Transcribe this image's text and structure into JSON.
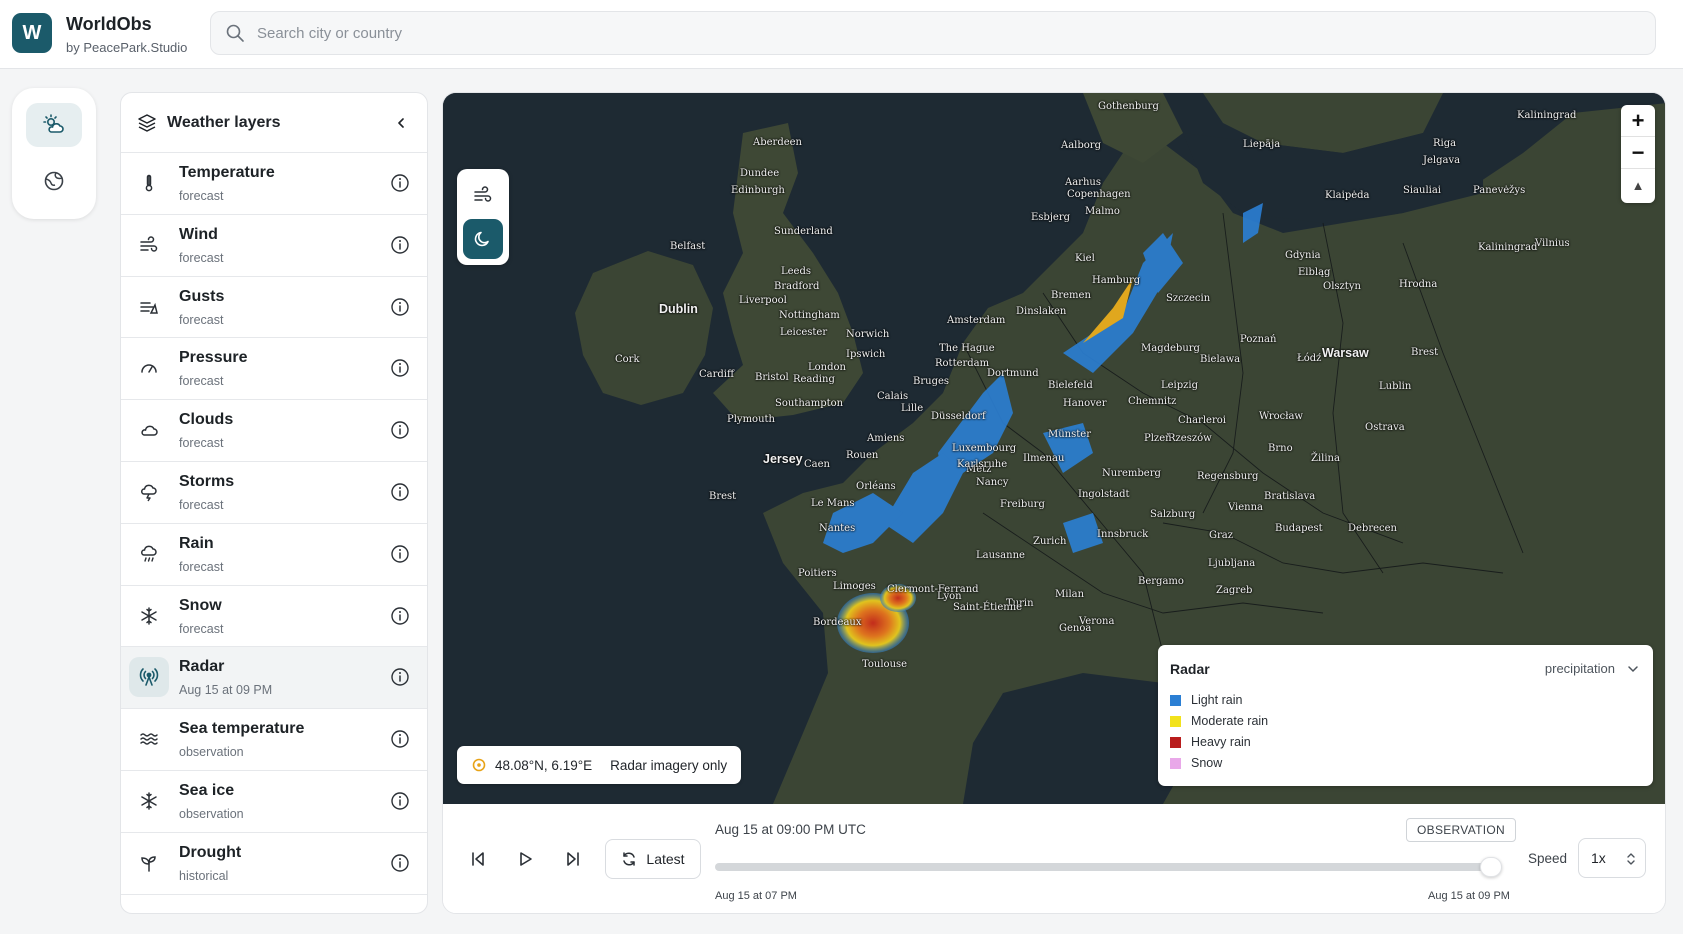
{
  "header": {
    "logo_letter": "W",
    "app_name": "WorldObs",
    "app_byline": "by PeacePark.Studio",
    "search_placeholder": "Search city or country"
  },
  "rail": {
    "items": [
      {
        "name": "weather",
        "icon": "sun-cloud-icon",
        "active": true
      },
      {
        "name": "globe",
        "icon": "globe-icon",
        "active": false
      }
    ]
  },
  "layers_panel": {
    "title": "Weather layers",
    "items": [
      {
        "label": "Temperature",
        "sub": "forecast",
        "icon": "thermometer-icon"
      },
      {
        "label": "Wind",
        "sub": "forecast",
        "icon": "wind-icon"
      },
      {
        "label": "Gusts",
        "sub": "forecast",
        "icon": "gusts-icon"
      },
      {
        "label": "Pressure",
        "sub": "forecast",
        "icon": "gauge-icon"
      },
      {
        "label": "Clouds",
        "sub": "forecast",
        "icon": "cloud-icon"
      },
      {
        "label": "Storms",
        "sub": "forecast",
        "icon": "storm-icon"
      },
      {
        "label": "Rain",
        "sub": "forecast",
        "icon": "rain-icon"
      },
      {
        "label": "Snow",
        "sub": "forecast",
        "icon": "snowflake-icon"
      },
      {
        "label": "Radar",
        "sub": "Aug 15 at 09 PM",
        "icon": "radar-icon",
        "active": true
      },
      {
        "label": "Sea temperature",
        "sub": "observation",
        "icon": "waves-icon"
      },
      {
        "label": "Sea ice",
        "sub": "observation",
        "icon": "snowflake-icon"
      },
      {
        "label": "Drought",
        "sub": "historical",
        "icon": "sprout-icon"
      }
    ]
  },
  "map": {
    "cities": [
      {
        "name": "Gothenburg"
      },
      {
        "name": "Kaliningrad"
      },
      {
        "name": "Aberdeen"
      },
      {
        "name": "Aalborg"
      },
      {
        "name": "Liepāja"
      },
      {
        "name": "Riga"
      },
      {
        "name": "Dundee"
      },
      {
        "name": "Jelgava"
      },
      {
        "name": "Edinburgh"
      },
      {
        "name": "Aarhus"
      },
      {
        "name": "Siauliai"
      },
      {
        "name": "Panevėžys"
      },
      {
        "name": "Copenhagen"
      },
      {
        "name": "Klaipėda"
      },
      {
        "name": "Malmo"
      },
      {
        "name": "Esbjerg"
      },
      {
        "name": "Sunderland"
      },
      {
        "name": "Belfast"
      },
      {
        "name": "Vilnius"
      },
      {
        "name": "Gdynia"
      },
      {
        "name": "Kiel"
      },
      {
        "name": "Kaliningrad"
      },
      {
        "name": "Leeds"
      },
      {
        "name": "Bradford"
      },
      {
        "name": "Hamburg"
      },
      {
        "name": "Elbląg"
      },
      {
        "name": "Dublin"
      },
      {
        "name": "Liverpool"
      },
      {
        "name": "Olsztyn"
      },
      {
        "name": "Hrodna"
      },
      {
        "name": "Nottingham"
      },
      {
        "name": "Bremen"
      },
      {
        "name": "Szczecin"
      },
      {
        "name": "Leicester"
      },
      {
        "name": "Norwich"
      },
      {
        "name": "Amsterdam"
      },
      {
        "name": "Dinslaken"
      },
      {
        "name": "Poznań"
      },
      {
        "name": "Ipswich"
      },
      {
        "name": "Cork"
      },
      {
        "name": "London"
      },
      {
        "name": "The Hague"
      },
      {
        "name": "Magdeburg"
      },
      {
        "name": "Warsaw"
      },
      {
        "name": "Brest"
      },
      {
        "name": "Cardiff"
      },
      {
        "name": "Bristol"
      },
      {
        "name": "Reading"
      },
      {
        "name": "Rotterdam"
      },
      {
        "name": "Bielefeld"
      },
      {
        "name": "Bielawa"
      },
      {
        "name": "Łódź"
      },
      {
        "name": "Southampton"
      },
      {
        "name": "Bruges"
      },
      {
        "name": "Dortmund"
      },
      {
        "name": "Calais"
      },
      {
        "name": "Leipzig"
      },
      {
        "name": "Lublin"
      },
      {
        "name": "Plymouth"
      },
      {
        "name": "Lille"
      },
      {
        "name": "Düsseldorf"
      },
      {
        "name": "Chemnitz"
      },
      {
        "name": "Hanover"
      },
      {
        "name": "Wrocław"
      },
      {
        "name": "Charleroi"
      },
      {
        "name": "Ostrava"
      },
      {
        "name": "Rzeszów"
      },
      {
        "name": "Amiens"
      },
      {
        "name": "Luxembourg"
      },
      {
        "name": "Münster"
      },
      {
        "name": "Plzeň"
      },
      {
        "name": "Jersey"
      },
      {
        "name": "Caen"
      },
      {
        "name": "Rouen"
      },
      {
        "name": "Brno"
      },
      {
        "name": "Žilina"
      },
      {
        "name": "Ilmenau"
      },
      {
        "name": "Metz"
      },
      {
        "name": "Karlsruhe"
      },
      {
        "name": "Nuremberg"
      },
      {
        "name": "Regensburg"
      },
      {
        "name": "Nancy"
      },
      {
        "name": "Vienna"
      },
      {
        "name": "Bratislava"
      },
      {
        "name": "Orléans"
      },
      {
        "name": "Brest"
      },
      {
        "name": "Ingolstadt"
      },
      {
        "name": "Freiburg"
      },
      {
        "name": "Salzburg"
      },
      {
        "name": "Le Mans"
      },
      {
        "name": "Budapest"
      },
      {
        "name": "Debrecen"
      },
      {
        "name": "Nantes"
      },
      {
        "name": "Zurich"
      },
      {
        "name": "Innsbruck"
      },
      {
        "name": "Graz"
      },
      {
        "name": "Lausanne"
      },
      {
        "name": "Ljubljana"
      },
      {
        "name": "Poitiers"
      },
      {
        "name": "Zagreb"
      },
      {
        "name": "Limoges"
      },
      {
        "name": "Clermont-Ferrand"
      },
      {
        "name": "Lyon"
      },
      {
        "name": "Bergamo"
      },
      {
        "name": "Milan"
      },
      {
        "name": "Verona"
      },
      {
        "name": "Turin"
      },
      {
        "name": "Bordeaux"
      },
      {
        "name": "Genoa"
      },
      {
        "name": "Toulouse"
      },
      {
        "name": "Saint-Étienne"
      }
    ],
    "coords_text": "48.08°N, 6.19°E",
    "mode_text": "Radar imagery only",
    "zoom_in": "+",
    "zoom_out": "−",
    "compass": "▲"
  },
  "legend": {
    "title": "Radar",
    "selected": "precipitation",
    "items": [
      {
        "label": "Light rain",
        "color": "#2b7fd4"
      },
      {
        "label": "Moderate rain",
        "color": "#f2e21c"
      },
      {
        "label": "Heavy rain",
        "color": "#b91d1d"
      },
      {
        "label": "Snow",
        "color": "#e9a8e9"
      }
    ]
  },
  "timeline": {
    "current": "Aug 15 at 09:00 PM UTC",
    "badge": "OBSERVATION",
    "start": "Aug 15 at 07 PM",
    "end": "Aug 15 at 09 PM",
    "latest_label": "Latest",
    "speed_label": "Speed",
    "speed_value": "1x",
    "progress": 1.0
  },
  "colors": {
    "brand": "#1b5a6a",
    "map_sea": "#1e2a33",
    "map_land": "#3b4534"
  }
}
